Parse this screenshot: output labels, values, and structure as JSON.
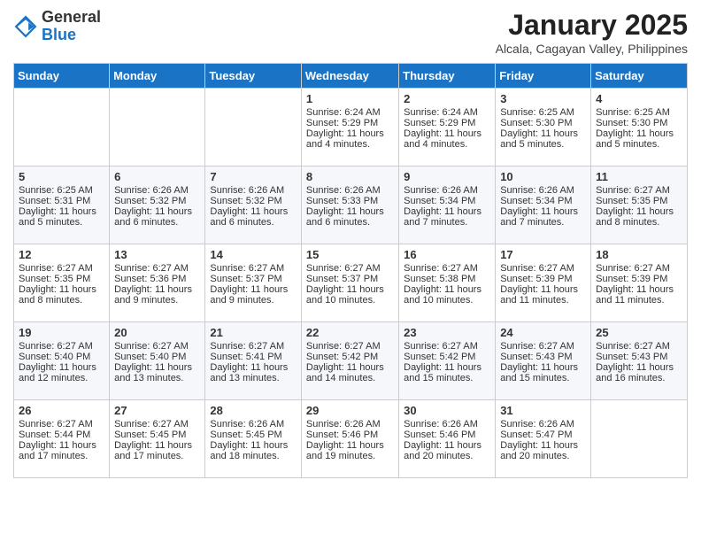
{
  "header": {
    "logo": {
      "line1": "General",
      "line2": "Blue"
    },
    "title": "January 2025",
    "location": "Alcala, Cagayan Valley, Philippines"
  },
  "days_of_week": [
    "Sunday",
    "Monday",
    "Tuesday",
    "Wednesday",
    "Thursday",
    "Friday",
    "Saturday"
  ],
  "weeks": [
    [
      {
        "day": "",
        "sunrise": "",
        "sunset": "",
        "daylight": ""
      },
      {
        "day": "",
        "sunrise": "",
        "sunset": "",
        "daylight": ""
      },
      {
        "day": "",
        "sunrise": "",
        "sunset": "",
        "daylight": ""
      },
      {
        "day": "1",
        "sunrise": "Sunrise: 6:24 AM",
        "sunset": "Sunset: 5:29 PM",
        "daylight": "Daylight: 11 hours and 4 minutes."
      },
      {
        "day": "2",
        "sunrise": "Sunrise: 6:24 AM",
        "sunset": "Sunset: 5:29 PM",
        "daylight": "Daylight: 11 hours and 4 minutes."
      },
      {
        "day": "3",
        "sunrise": "Sunrise: 6:25 AM",
        "sunset": "Sunset: 5:30 PM",
        "daylight": "Daylight: 11 hours and 5 minutes."
      },
      {
        "day": "4",
        "sunrise": "Sunrise: 6:25 AM",
        "sunset": "Sunset: 5:30 PM",
        "daylight": "Daylight: 11 hours and 5 minutes."
      }
    ],
    [
      {
        "day": "5",
        "sunrise": "Sunrise: 6:25 AM",
        "sunset": "Sunset: 5:31 PM",
        "daylight": "Daylight: 11 hours and 5 minutes."
      },
      {
        "day": "6",
        "sunrise": "Sunrise: 6:26 AM",
        "sunset": "Sunset: 5:32 PM",
        "daylight": "Daylight: 11 hours and 6 minutes."
      },
      {
        "day": "7",
        "sunrise": "Sunrise: 6:26 AM",
        "sunset": "Sunset: 5:32 PM",
        "daylight": "Daylight: 11 hours and 6 minutes."
      },
      {
        "day": "8",
        "sunrise": "Sunrise: 6:26 AM",
        "sunset": "Sunset: 5:33 PM",
        "daylight": "Daylight: 11 hours and 6 minutes."
      },
      {
        "day": "9",
        "sunrise": "Sunrise: 6:26 AM",
        "sunset": "Sunset: 5:34 PM",
        "daylight": "Daylight: 11 hours and 7 minutes."
      },
      {
        "day": "10",
        "sunrise": "Sunrise: 6:26 AM",
        "sunset": "Sunset: 5:34 PM",
        "daylight": "Daylight: 11 hours and 7 minutes."
      },
      {
        "day": "11",
        "sunrise": "Sunrise: 6:27 AM",
        "sunset": "Sunset: 5:35 PM",
        "daylight": "Daylight: 11 hours and 8 minutes."
      }
    ],
    [
      {
        "day": "12",
        "sunrise": "Sunrise: 6:27 AM",
        "sunset": "Sunset: 5:35 PM",
        "daylight": "Daylight: 11 hours and 8 minutes."
      },
      {
        "day": "13",
        "sunrise": "Sunrise: 6:27 AM",
        "sunset": "Sunset: 5:36 PM",
        "daylight": "Daylight: 11 hours and 9 minutes."
      },
      {
        "day": "14",
        "sunrise": "Sunrise: 6:27 AM",
        "sunset": "Sunset: 5:37 PM",
        "daylight": "Daylight: 11 hours and 9 minutes."
      },
      {
        "day": "15",
        "sunrise": "Sunrise: 6:27 AM",
        "sunset": "Sunset: 5:37 PM",
        "daylight": "Daylight: 11 hours and 10 minutes."
      },
      {
        "day": "16",
        "sunrise": "Sunrise: 6:27 AM",
        "sunset": "Sunset: 5:38 PM",
        "daylight": "Daylight: 11 hours and 10 minutes."
      },
      {
        "day": "17",
        "sunrise": "Sunrise: 6:27 AM",
        "sunset": "Sunset: 5:39 PM",
        "daylight": "Daylight: 11 hours and 11 minutes."
      },
      {
        "day": "18",
        "sunrise": "Sunrise: 6:27 AM",
        "sunset": "Sunset: 5:39 PM",
        "daylight": "Daylight: 11 hours and 11 minutes."
      }
    ],
    [
      {
        "day": "19",
        "sunrise": "Sunrise: 6:27 AM",
        "sunset": "Sunset: 5:40 PM",
        "daylight": "Daylight: 11 hours and 12 minutes."
      },
      {
        "day": "20",
        "sunrise": "Sunrise: 6:27 AM",
        "sunset": "Sunset: 5:40 PM",
        "daylight": "Daylight: 11 hours and 13 minutes."
      },
      {
        "day": "21",
        "sunrise": "Sunrise: 6:27 AM",
        "sunset": "Sunset: 5:41 PM",
        "daylight": "Daylight: 11 hours and 13 minutes."
      },
      {
        "day": "22",
        "sunrise": "Sunrise: 6:27 AM",
        "sunset": "Sunset: 5:42 PM",
        "daylight": "Daylight: 11 hours and 14 minutes."
      },
      {
        "day": "23",
        "sunrise": "Sunrise: 6:27 AM",
        "sunset": "Sunset: 5:42 PM",
        "daylight": "Daylight: 11 hours and 15 minutes."
      },
      {
        "day": "24",
        "sunrise": "Sunrise: 6:27 AM",
        "sunset": "Sunset: 5:43 PM",
        "daylight": "Daylight: 11 hours and 15 minutes."
      },
      {
        "day": "25",
        "sunrise": "Sunrise: 6:27 AM",
        "sunset": "Sunset: 5:43 PM",
        "daylight": "Daylight: 11 hours and 16 minutes."
      }
    ],
    [
      {
        "day": "26",
        "sunrise": "Sunrise: 6:27 AM",
        "sunset": "Sunset: 5:44 PM",
        "daylight": "Daylight: 11 hours and 17 minutes."
      },
      {
        "day": "27",
        "sunrise": "Sunrise: 6:27 AM",
        "sunset": "Sunset: 5:45 PM",
        "daylight": "Daylight: 11 hours and 17 minutes."
      },
      {
        "day": "28",
        "sunrise": "Sunrise: 6:26 AM",
        "sunset": "Sunset: 5:45 PM",
        "daylight": "Daylight: 11 hours and 18 minutes."
      },
      {
        "day": "29",
        "sunrise": "Sunrise: 6:26 AM",
        "sunset": "Sunset: 5:46 PM",
        "daylight": "Daylight: 11 hours and 19 minutes."
      },
      {
        "day": "30",
        "sunrise": "Sunrise: 6:26 AM",
        "sunset": "Sunset: 5:46 PM",
        "daylight": "Daylight: 11 hours and 20 minutes."
      },
      {
        "day": "31",
        "sunrise": "Sunrise: 6:26 AM",
        "sunset": "Sunset: 5:47 PM",
        "daylight": "Daylight: 11 hours and 20 minutes."
      },
      {
        "day": "",
        "sunrise": "",
        "sunset": "",
        "daylight": ""
      }
    ]
  ]
}
